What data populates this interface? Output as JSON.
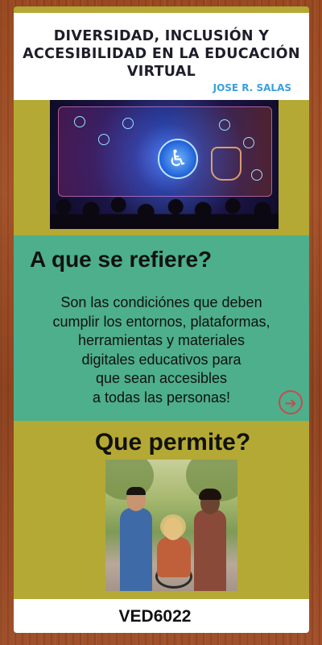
{
  "header": {
    "title": "DIVERSIDAD, INCLUSIÓN Y ACCESIBILIDAD EN LA EDUCACIÓN VIRTUAL",
    "author": "JOSE R. SALAS"
  },
  "section1": {
    "heading": "A que se refiere?",
    "lines": [
      "Son las condiciónes que deben",
      "cumplir los entornos,  plataformas,",
      "herramientas y materiales",
      "digitales educativos para",
      "que sean accesibles",
      "a todas las personas!"
    ],
    "arrow_icon": "arrow-right-circle-icon"
  },
  "section2": {
    "heading": "Que permite?"
  },
  "footer": {
    "code": "VED6022"
  },
  "colors": {
    "board": "#b4a934",
    "teal": "#4daf8c",
    "author": "#3aa0dd",
    "arrow": "#c84b4b"
  }
}
